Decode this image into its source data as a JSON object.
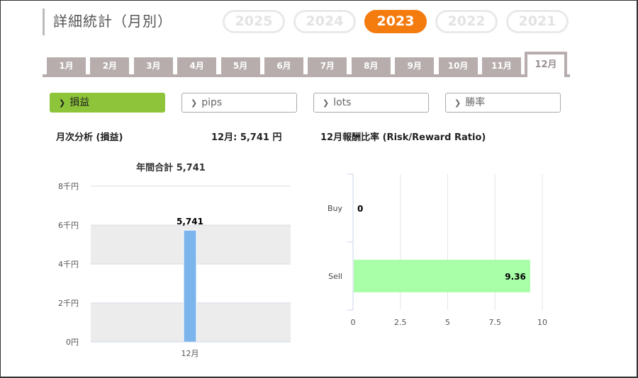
{
  "page": {
    "title": "詳細統計（月別）"
  },
  "years": [
    {
      "label": "2025",
      "active": false
    },
    {
      "label": "2024",
      "active": false
    },
    {
      "label": "2023",
      "active": true
    },
    {
      "label": "2022",
      "active": false
    },
    {
      "label": "2021",
      "active": false
    }
  ],
  "months": [
    "1月",
    "2月",
    "3月",
    "4月",
    "5月",
    "6月",
    "7月",
    "8月",
    "9月",
    "10月",
    "11月",
    "12月"
  ],
  "active_month_index": 11,
  "metrics": [
    {
      "label": "損益",
      "active": true
    },
    {
      "label": "pips",
      "active": false
    },
    {
      "label": "lots",
      "active": false
    },
    {
      "label": "勝率",
      "active": false
    }
  ],
  "colors": {
    "accent": "#f47b0e",
    "metric_active": "#8ec43a",
    "bar": "#7cb5ec",
    "bar_sell": "#a8ffa8",
    "tab": "#b7adad"
  },
  "left_panel": {
    "title": "月次分析 (損益)",
    "summary": "12月:  5,741 円"
  },
  "right_panel": {
    "title": "12月報酬比率 (Risk/Reward Ratio)"
  },
  "chart_data": [
    {
      "type": "bar",
      "title": "年間合計 5,741",
      "categories": [
        "12月"
      ],
      "values": [
        5741
      ],
      "data_labels": [
        "5,741"
      ],
      "yticks": [
        "0円",
        "2千円",
        "4千円",
        "6千円",
        "8千円"
      ],
      "ylim": [
        0,
        8000
      ],
      "grid": true,
      "legend": "none"
    },
    {
      "type": "bar",
      "orientation": "horizontal",
      "categories": [
        "Buy",
        "Sell"
      ],
      "values": [
        0,
        9.36
      ],
      "data_labels": [
        "0",
        "9.36"
      ],
      "xticks": [
        "0",
        "2.5",
        "5",
        "7.5",
        "10"
      ],
      "xlim": [
        0,
        10
      ],
      "grid": true,
      "legend": "none"
    }
  ]
}
